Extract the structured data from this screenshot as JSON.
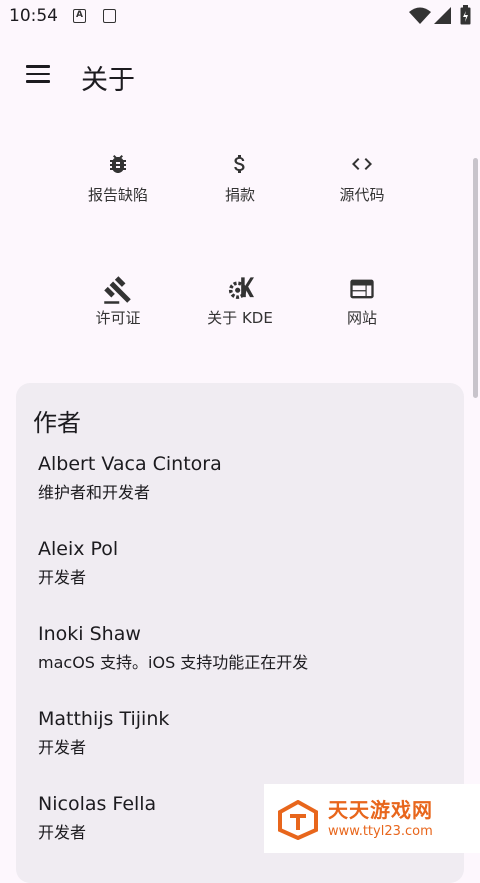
{
  "status": {
    "time": "10:54",
    "icon_a": "A"
  },
  "appbar": {
    "title": "关于"
  },
  "actions": [
    {
      "label": "报告缺陷",
      "icon": "bug-icon"
    },
    {
      "label": "捐款",
      "icon": "dollar-icon"
    },
    {
      "label": "源代码",
      "icon": "code-icon"
    },
    {
      "label": "许可证",
      "icon": "gavel-icon"
    },
    {
      "label": "关于 KDE",
      "icon": "kde-icon"
    },
    {
      "label": "网站",
      "icon": "web-icon"
    }
  ],
  "authors_card": {
    "title": "作者",
    "items": [
      {
        "name": "Albert Vaca Cintora",
        "role": "维护者和开发者"
      },
      {
        "name": "Aleix Pol",
        "role": "开发者"
      },
      {
        "name": "Inoki Shaw",
        "role": "macOS 支持。iOS 支持功能正在开发"
      },
      {
        "name": "Matthijs Tijink",
        "role": "开发者"
      },
      {
        "name": "Nicolas Fella",
        "role": "开发者"
      }
    ]
  },
  "watermark": {
    "title": "天天游戏网",
    "url": "www.ttyl23.com"
  }
}
